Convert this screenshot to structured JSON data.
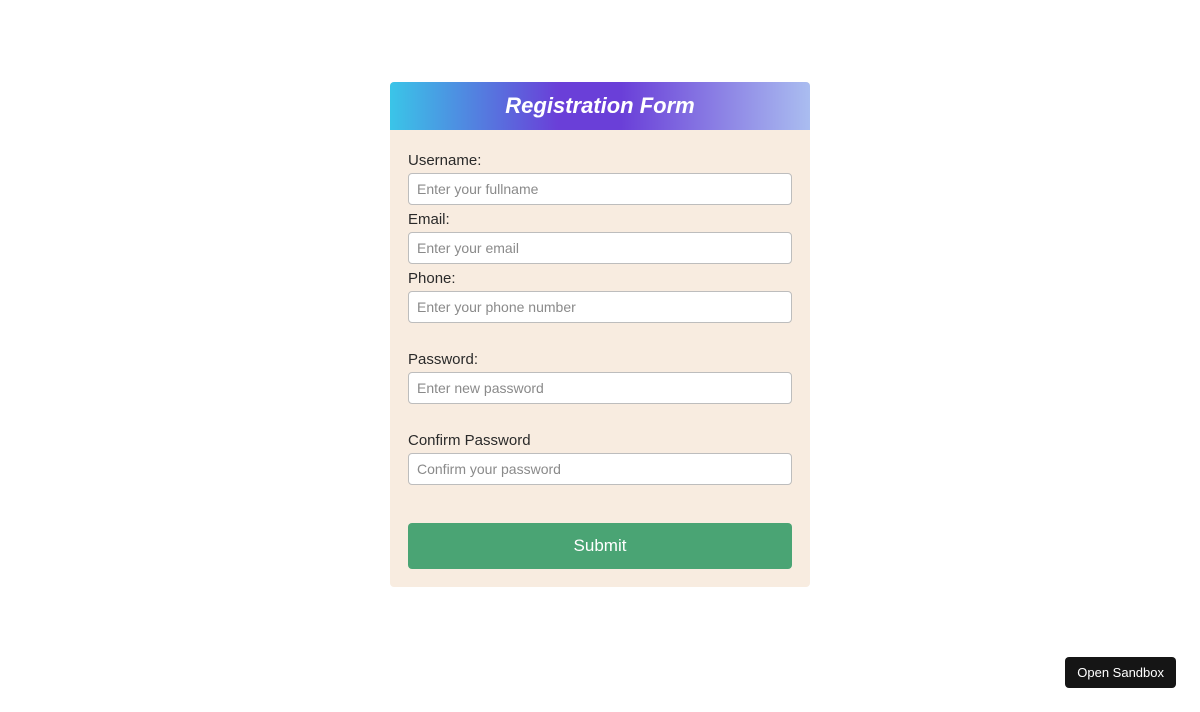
{
  "header": {
    "title": "Registration Form"
  },
  "fields": {
    "username": {
      "label": "Username:",
      "placeholder": "Enter your fullname"
    },
    "email": {
      "label": "Email:",
      "placeholder": "Enter your email"
    },
    "phone": {
      "label": "Phone:",
      "placeholder": "Enter your phone number"
    },
    "password": {
      "label": "Password:",
      "placeholder": "Enter new password"
    },
    "confirm": {
      "label": "Confirm Password",
      "placeholder": "Confirm your password"
    }
  },
  "submit": {
    "label": "Submit"
  },
  "sandbox": {
    "label": "Open Sandbox"
  }
}
